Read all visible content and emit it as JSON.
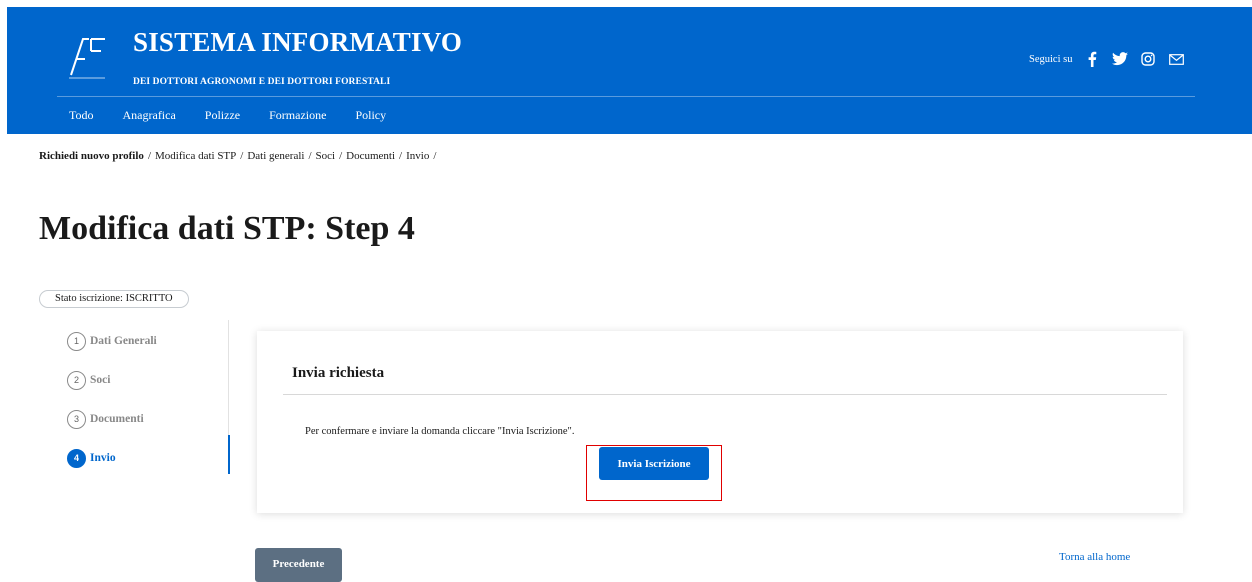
{
  "header": {
    "title": "SISTEMA INFORMATIVO",
    "subtitle": "DEI DOTTORI AGRONOMI E DEI DOTTORI FORESTALI",
    "follow_label": "Seguici su",
    "social_icons": [
      "facebook-icon",
      "twitter-icon",
      "instagram-icon",
      "mail-icon"
    ],
    "brand_color": "#0066cc"
  },
  "nav": {
    "items": [
      "Todo",
      "Anagrafica",
      "Polizze",
      "Formazione",
      "Policy"
    ]
  },
  "breadcrumb": {
    "items": [
      "Richiedi nuovo profilo",
      "Modifica dati STP",
      "Dati generali",
      "Soci",
      "Documenti",
      "Invio"
    ],
    "separator": "/"
  },
  "page": {
    "title": "Modifica dati STP: Step 4",
    "status": "Stato iscrizione: ISCRITTO"
  },
  "steps": [
    {
      "number": "1",
      "label": "Dati Generali",
      "active": false
    },
    {
      "number": "2",
      "label": "Soci",
      "active": false
    },
    {
      "number": "3",
      "label": "Documenti",
      "active": false
    },
    {
      "number": "4",
      "label": "Invio",
      "active": true
    }
  ],
  "card": {
    "title": "Invia richiesta",
    "text": "Per confermare e inviare la domanda cliccare \"Invia Iscrizione\".",
    "button_label": "Invia Iscrizione"
  },
  "footer": {
    "prev_label": "Precedente",
    "home_link": "Torna alla home"
  },
  "colors": {
    "primary": "#0066cc",
    "secondary_button": "#5c6f82",
    "highlight": "#e00000"
  }
}
